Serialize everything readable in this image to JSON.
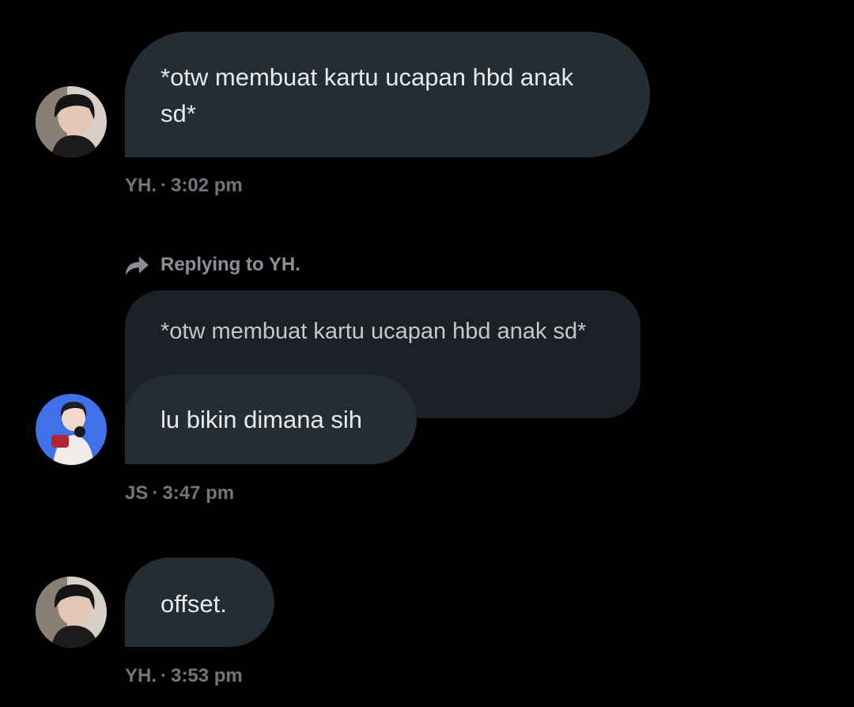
{
  "messages": [
    {
      "sender": "YH.",
      "separator": "·",
      "time": "3:02 pm",
      "text_line1": "*otw membuat kartu ucapan hbd anak",
      "text_line2": "sd*"
    },
    {
      "sender": "JS",
      "separator": "·",
      "time": "3:47 pm",
      "reply_label": "Replying to YH.",
      "quoted_text": "*otw membuat kartu ucapan hbd anak sd*",
      "text": "lu bikin dimana sih"
    },
    {
      "sender": "YH.",
      "separator": "·",
      "time": "3:53 pm",
      "text": "offset."
    }
  ],
  "icons": {
    "reply": "reply-arrow-icon",
    "avatar_yh": "avatar-photo-dark",
    "avatar_js": "avatar-photo-blue"
  },
  "colors": {
    "background": "#000000",
    "bubble": "#252d34",
    "quoted_bubble": "#1b2126",
    "meta_text": "#71767b",
    "message_text": "#e7e9ea"
  }
}
